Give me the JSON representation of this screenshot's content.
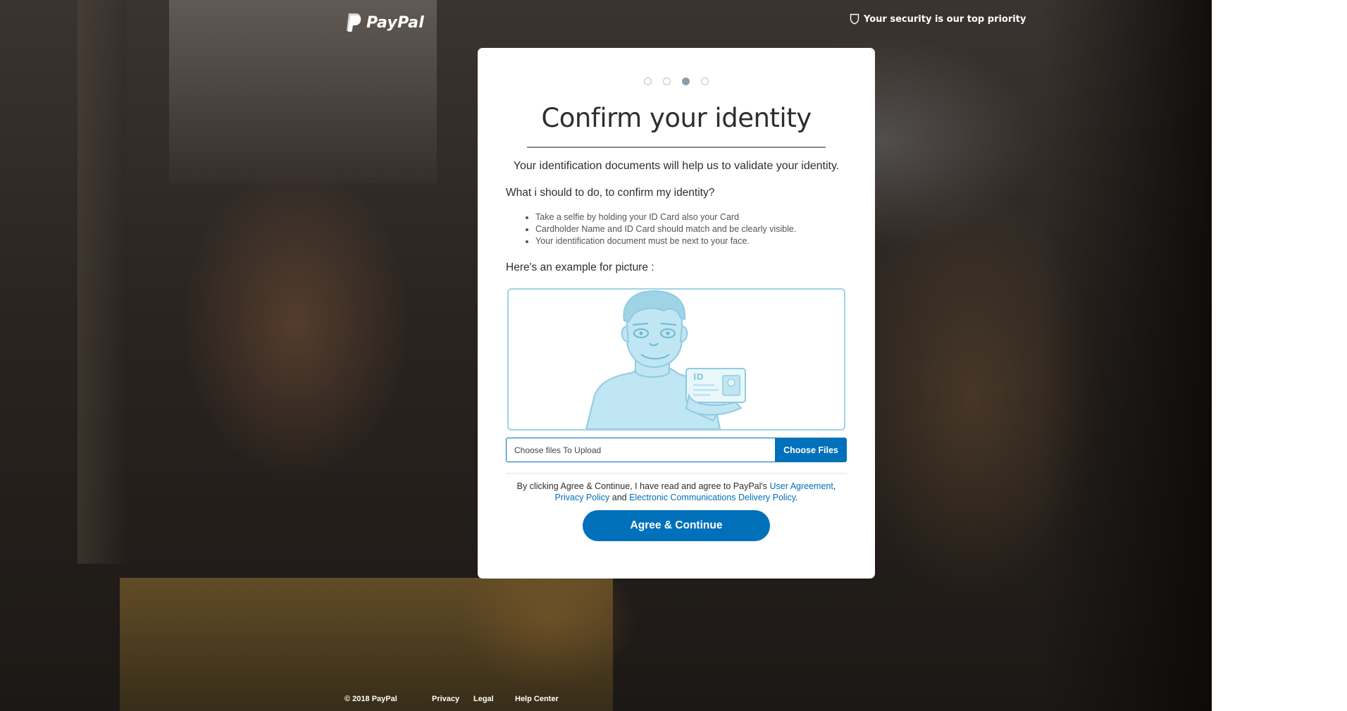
{
  "header": {
    "brand": "PayPal",
    "security_text": "Your security is our top priority"
  },
  "progress": {
    "steps_total": 4,
    "current_step": 3
  },
  "card": {
    "title": "Confirm your identity",
    "intro": "Your identification documents will help us to validate your identity.",
    "question": "What i should to do, to confirm my identity?",
    "instructions": [
      "Take a selfie by holding your ID Card also your Card",
      "Cardholder Name and ID Card should match and be clearly visible.",
      "Your identification document must be next to your face."
    ],
    "example_label": "Here's an example for picture :",
    "example_id_text": "ID"
  },
  "upload": {
    "placeholder": "Choose files To Upload",
    "button_label": "Choose Files"
  },
  "legal": {
    "prefix": "By clicking Agree & Continue, I have read and agree to PayPal's ",
    "user_agreement": "User Agreement",
    "comma": ", ",
    "privacy_policy": "Privacy Policy",
    "and": " and ",
    "ecd_policy": "Electronic Communications Delivery Policy",
    "suffix": "."
  },
  "cta": {
    "label": "Agree & Continue"
  },
  "footer": {
    "copyright": "© 2018 PayPal",
    "privacy": "Privacy",
    "legal": "Legal",
    "help": "Help Center"
  },
  "colors": {
    "accent": "#0070ba",
    "illustration": "#9fd3e6",
    "title_text": "#2c2e2f"
  }
}
